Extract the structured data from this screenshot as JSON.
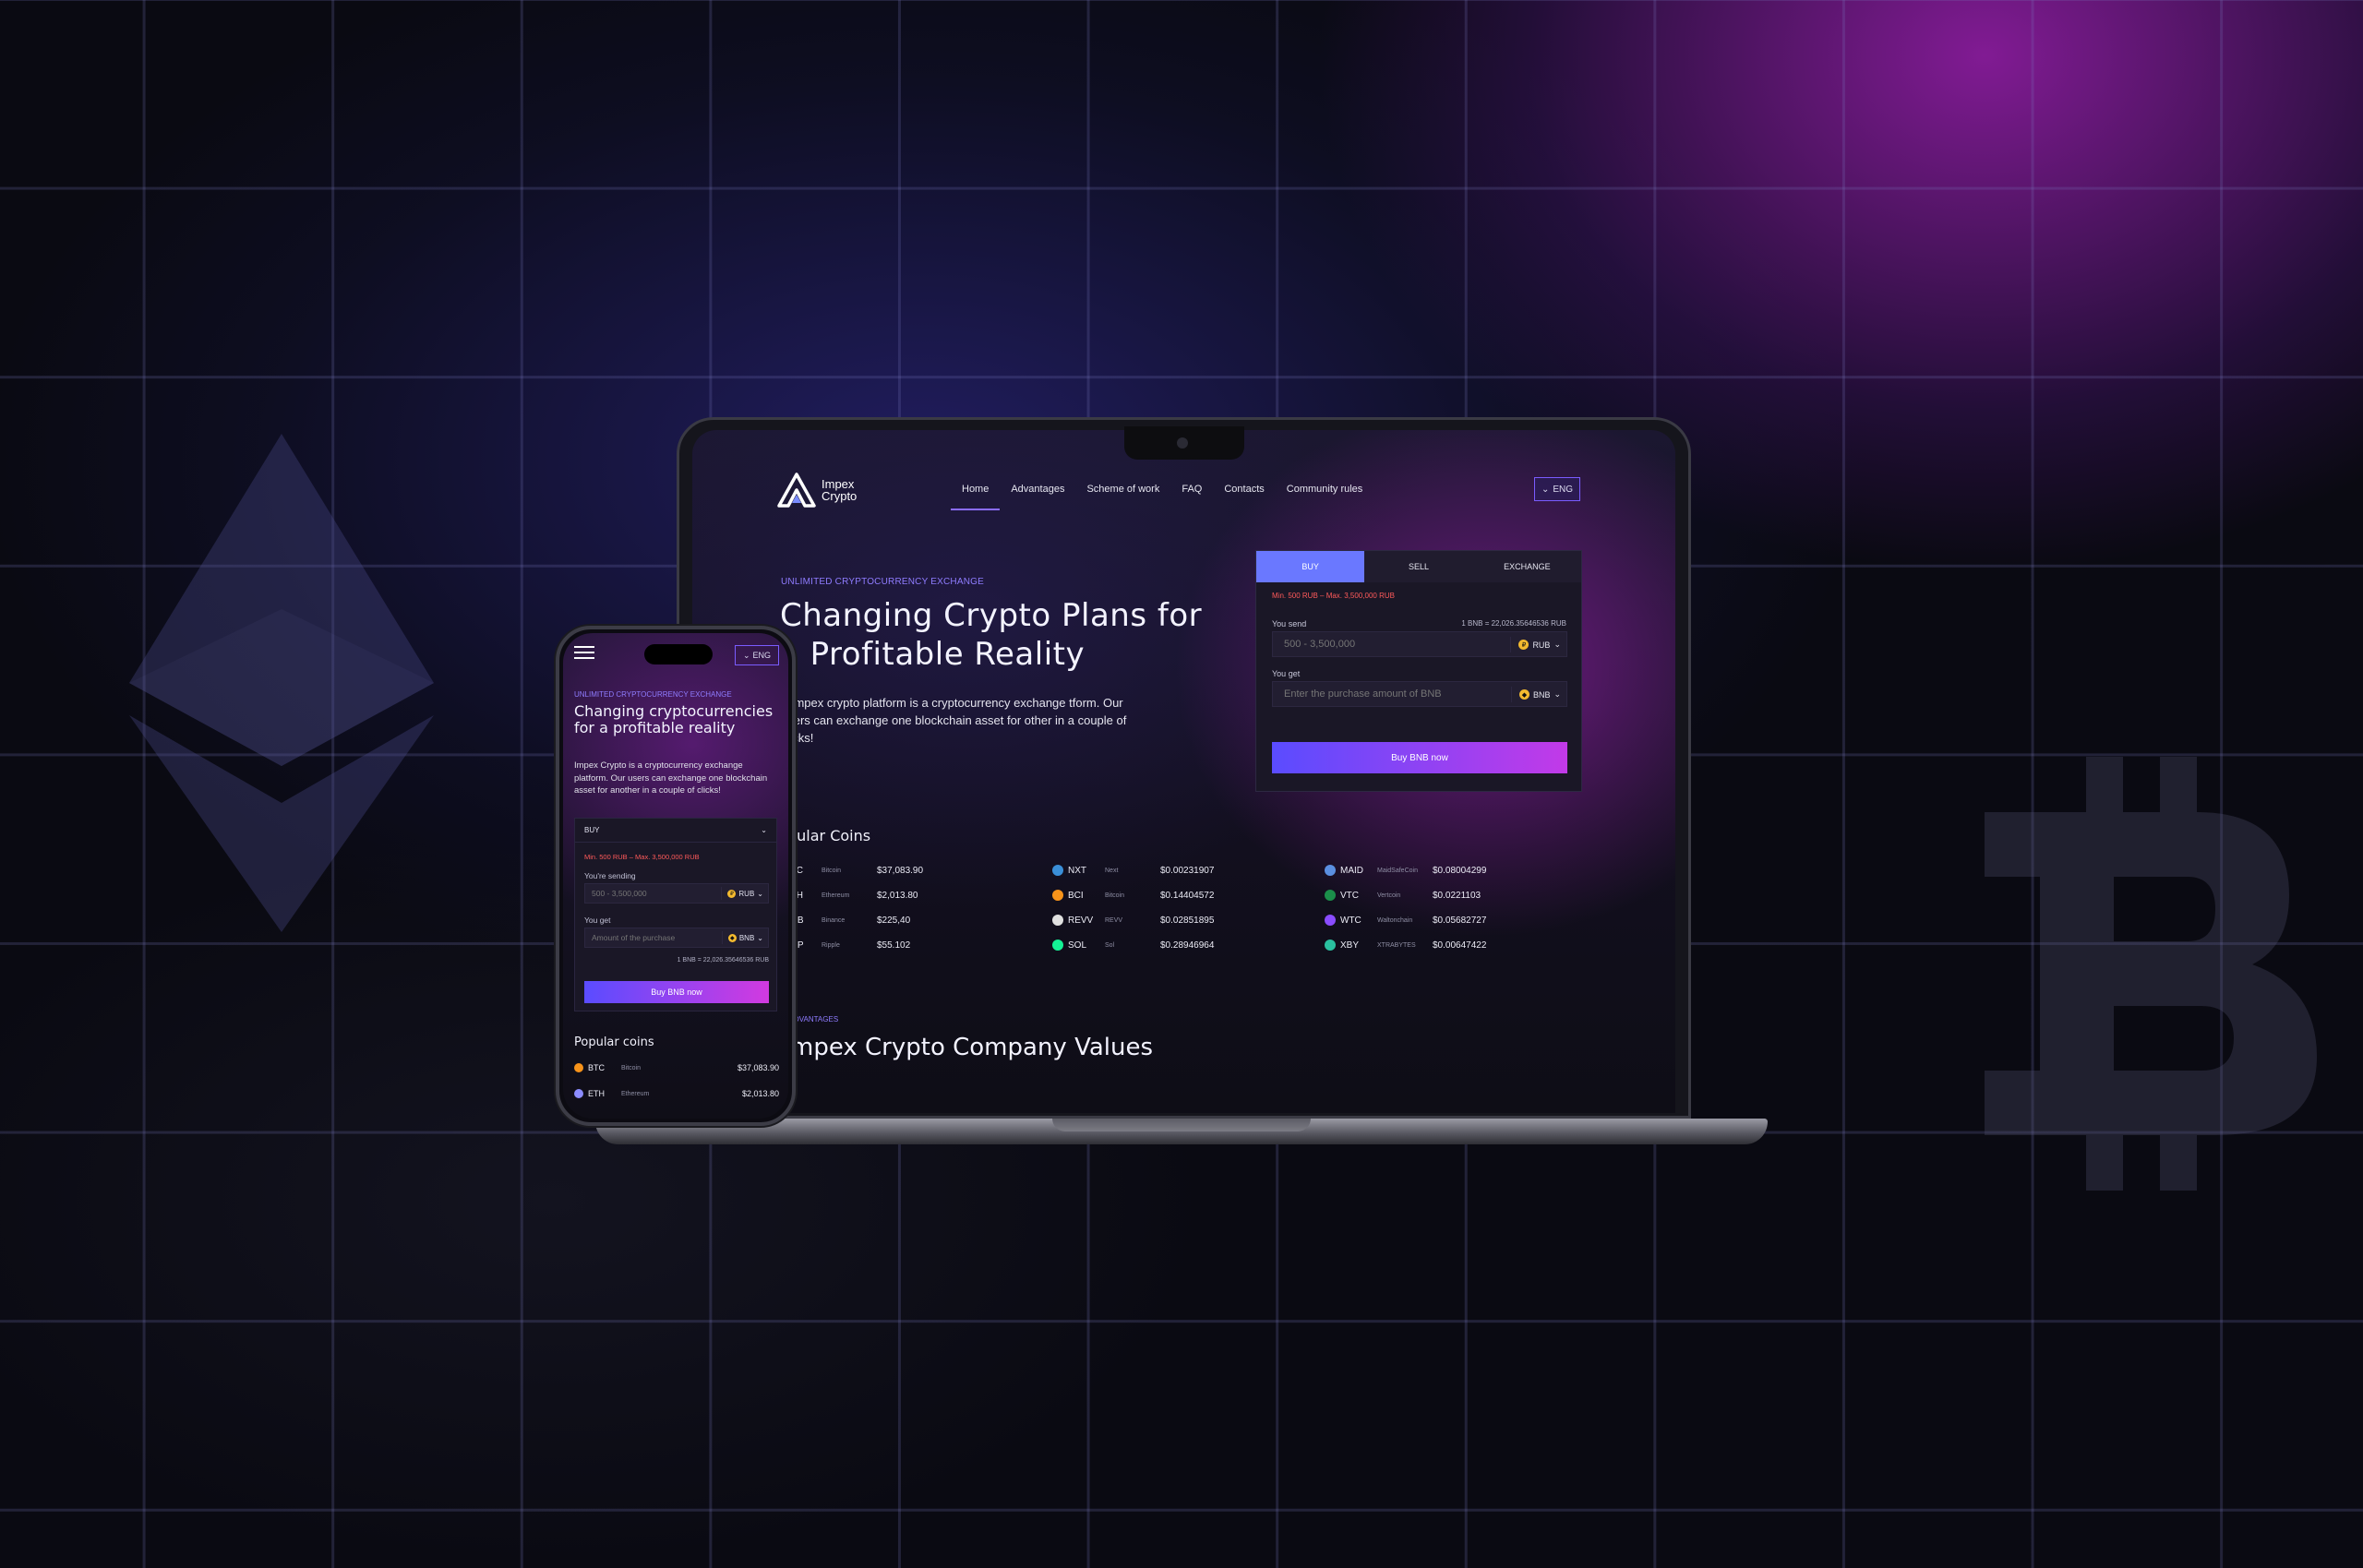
{
  "brand": {
    "name_line1": "Impex",
    "name_line2": "Crypto"
  },
  "nav": {
    "items": [
      "Home",
      "Advantages",
      "Scheme of work",
      "FAQ",
      "Contacts",
      "Community rules"
    ],
    "active": "Home",
    "lang": "ENG"
  },
  "hero": {
    "kicker": "UNLIMITED CRYPTOCURRENCY EXCHANGE",
    "title": "Changing Crypto Plans for a Profitable Reality",
    "description": "e Impex crypto platform is a cryptocurrency exchange tform. Our users can exchange one blockchain asset for other in a couple of clicks!"
  },
  "exchange": {
    "tabs": [
      "BUY",
      "SELL",
      "EXCHANGE"
    ],
    "active_tab": "BUY",
    "limits": "Min. 500 RUB – Max. 3,500,000 RUB",
    "send_label": "You send",
    "rate": "1 BNB = 22,026.35646536 RUB",
    "send_placeholder": "500 - 3,500,000",
    "send_currency": "RUB",
    "get_label": "You get",
    "get_placeholder": "Enter the purchase amount of BNB",
    "get_currency": "BNB",
    "button": "Buy BNB now"
  },
  "popular": {
    "title": "pular Coins",
    "columns": [
      [
        {
          "symbol": "BTC",
          "name": "Bitcoin",
          "price": "$37,083.90",
          "color": "#f7931a"
        },
        {
          "symbol": "ETH",
          "name": "Ethereum",
          "price": "$2,013.80",
          "color": "#8c8cff"
        },
        {
          "symbol": "BNB",
          "name": "Binance",
          "price": "$225,40",
          "color": "#f3ba2f"
        },
        {
          "symbol": "XRP",
          "name": "Ripple",
          "price": "$55.102",
          "color": "#9aa0b0"
        }
      ],
      [
        {
          "symbol": "NXT",
          "name": "Next",
          "price": "$0.00231907",
          "color": "#3a8fd8"
        },
        {
          "symbol": "BCI",
          "name": "Bitcoin",
          "price": "$0.14404572",
          "color": "#f7931a"
        },
        {
          "symbol": "REVV",
          "name": "REVV",
          "price": "$0.02851895",
          "color": "#e0e0e0"
        },
        {
          "symbol": "SOL",
          "name": "Sol",
          "price": "$0.28946964",
          "color": "#14f195"
        }
      ],
      [
        {
          "symbol": "MAID",
          "name": "MaidSafeCoin",
          "price": "$0.08004299",
          "color": "#5a8fe0"
        },
        {
          "symbol": "VTC",
          "name": "Vertcoin",
          "price": "$0.0221103",
          "color": "#1b8f4a"
        },
        {
          "symbol": "WTC",
          "name": "Waltonchain",
          "price": "$0.05682727",
          "color": "#8a4cff"
        },
        {
          "symbol": "XBY",
          "name": "XTRABYTES",
          "price": "$0.00647422",
          "color": "#2ac0a0"
        }
      ]
    ]
  },
  "advantages": {
    "kicker": "DVANTAGES",
    "title": "mpex Crypto Company Values"
  },
  "mobile": {
    "lang": "ENG",
    "kicker": "UNLIMITED CRYPTOCURRENCY EXCHANGE",
    "title": "Changing cryptocurrencies for a profitable reality",
    "description": "Impex Crypto is a cryptocurrency exchange platform. Our users can exchange one blockchain asset for another in a couple of clicks!",
    "mode": "BUY",
    "limits": "Min. 500 RUB – Max. 3,500,000 RUB",
    "send_label": "You're sending",
    "send_placeholder": "500 - 3,500,000",
    "send_currency": "RUB",
    "get_label": "You get",
    "get_placeholder": "Amount of the purchase",
    "get_currency": "BNB",
    "rate": "1 BNB = 22,026.35646536 RUB",
    "button": "Buy BNB now",
    "popular_title": "Popular coins",
    "coins": [
      {
        "symbol": "BTC",
        "name": "Bitcoin",
        "price": "$37,083.90",
        "color": "#f7931a"
      },
      {
        "symbol": "ETH",
        "name": "Ethereum",
        "price": "$2,013.80",
        "color": "#8c8cff"
      }
    ]
  }
}
